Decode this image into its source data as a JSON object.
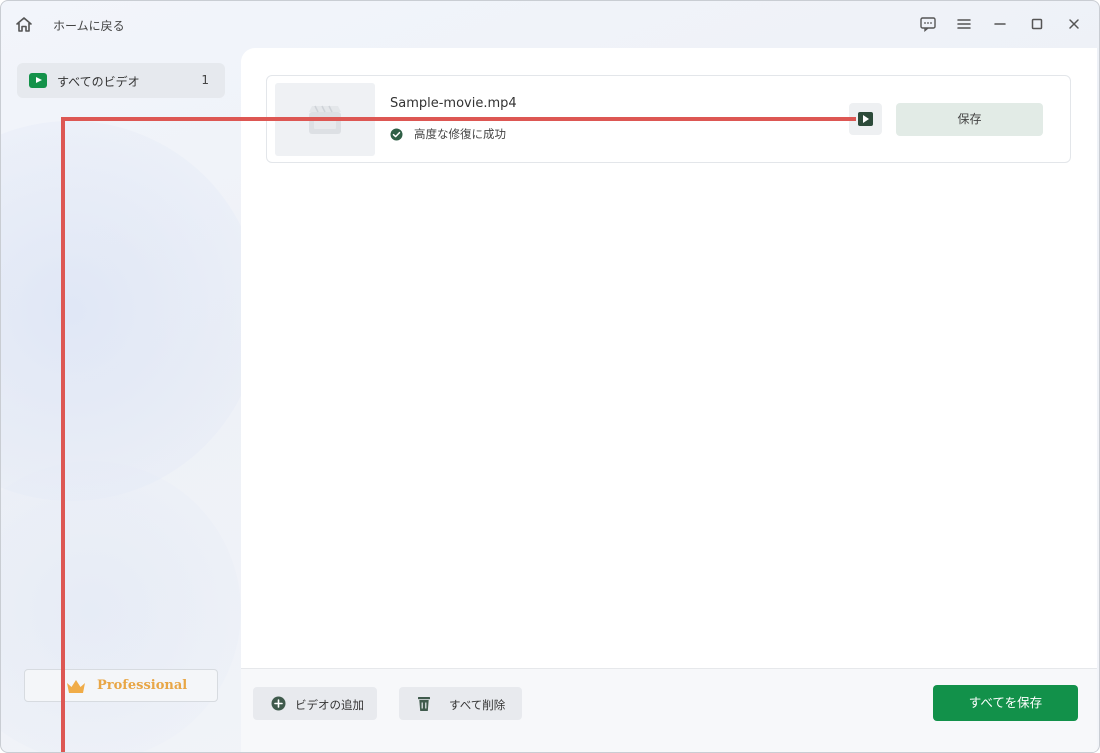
{
  "titlebar": {
    "home_label": "ホームに戻る",
    "icons": [
      "home-icon",
      "feedback-icon",
      "menu-icon",
      "minimize-icon",
      "maximize-icon",
      "close-icon"
    ]
  },
  "sidebar": {
    "items": [
      {
        "label": "すべてのビデオ",
        "count": "1",
        "icon": "video-play-icon"
      }
    ],
    "pro_label": "Professional",
    "pro_icon": "crown-icon"
  },
  "main": {
    "videos": [
      {
        "file_name": "Sample-movie.mp4",
        "status": "高度な修復に成功",
        "save_label": "保存"
      }
    ]
  },
  "bottombar": {
    "add_label": "ビデオの追加",
    "delete_all_label": "すべて削除",
    "save_all_label": "すべてを保存"
  },
  "colors": {
    "accent": "#12914a",
    "crown": "#e8a646",
    "annotation": "#dd5753"
  }
}
